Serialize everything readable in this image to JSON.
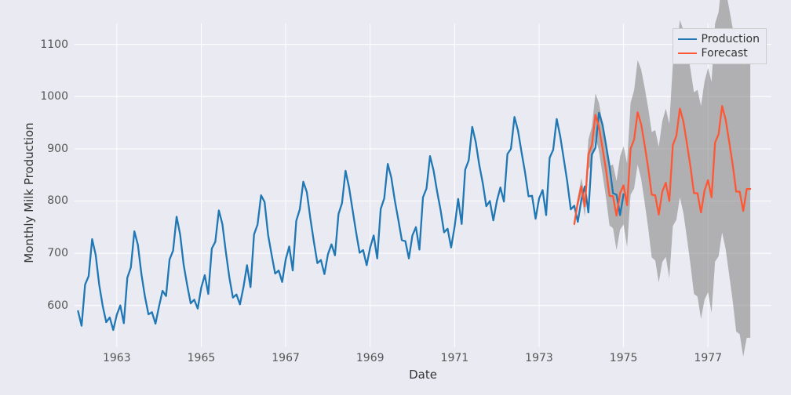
{
  "chart_data": {
    "type": "line",
    "xlabel": "Date",
    "ylabel": "Monthly Milk Production",
    "title": "",
    "xlim_year": [
      1962.0,
      1978.5
    ],
    "ylim": [
      520,
      1140
    ],
    "x_ticks": [
      1963,
      1965,
      1967,
      1969,
      1971,
      1973,
      1975,
      1977
    ],
    "y_ticks": [
      600,
      700,
      800,
      900,
      1000,
      1100
    ],
    "legend": {
      "entries": [
        "Production",
        "Forecast"
      ]
    },
    "series": [
      {
        "name": "Production",
        "color": "#1f77b4",
        "x_start_year": 1962.0833,
        "x_step_years": 0.0833333,
        "values": [
          589,
          561,
          640,
          656,
          727,
          697,
          640,
          599,
          568,
          577,
          553,
          582,
          600,
          566,
          653,
          673,
          742,
          716,
          660,
          617,
          583,
          587,
          565,
          598,
          628,
          618,
          688,
          705,
          770,
          736,
          678,
          639,
          604,
          611,
          594,
          634,
          658,
          622,
          709,
          722,
          782,
          756,
          702,
          653,
          615,
          621,
          602,
          635,
          677,
          635,
          736,
          755,
          811,
          798,
          735,
          697,
          661,
          667,
          645,
          688,
          713,
          667,
          762,
          784,
          837,
          817,
          767,
          722,
          681,
          687,
          660,
          698,
          717,
          696,
          775,
          796,
          858,
          826,
          783,
          740,
          701,
          706,
          677,
          711,
          734,
          690,
          785,
          805,
          871,
          845,
          801,
          764,
          725,
          723,
          690,
          734,
          750,
          707,
          807,
          824,
          886,
          859,
          819,
          783,
          740,
          747,
          711,
          751,
          804,
          756,
          860,
          878,
          942,
          913,
          869,
          834,
          790,
          800,
          763,
          800,
          826,
          799,
          890,
          900,
          961,
          935,
          894,
          855,
          809,
          810,
          766,
          805,
          821,
          773,
          883,
          898,
          957,
          924,
          881,
          837,
          784,
          791,
          760,
          802,
          828,
          778,
          889,
          902,
          969,
          947,
          908,
          867,
          815,
          812,
          773,
          813
        ]
      },
      {
        "name": "Forecast",
        "color": "#ff5733",
        "x_start_year": 1973.8333,
        "x_step_years": 0.0833333,
        "values": [
          756,
          798,
          828,
          790,
          889,
          907,
          965,
          942,
          902,
          860,
          810,
          809,
          772,
          815,
          830,
          792,
          900,
          918,
          970,
          947,
          907,
          863,
          812,
          811,
          774,
          818,
          835,
          800,
          907,
          925,
          977,
          952,
          910,
          866,
          815,
          815,
          778,
          820,
          840,
          807,
          912,
          928,
          982,
          956,
          914,
          870,
          818,
          818,
          781,
          823,
          823
        ]
      }
    ],
    "confidence_band": {
      "x_start_year": 1973.8333,
      "x_step_years": 0.0833333,
      "lower": [
        750,
        788,
        812,
        770,
        860,
        872,
        924,
        896,
        852,
        807,
        753,
        748,
        706,
        745,
        755,
        712,
        812,
        824,
        870,
        842,
        797,
        748,
        692,
        686,
        644,
        683,
        693,
        652,
        752,
        764,
        807,
        777,
        729,
        679,
        622,
        617,
        574,
        611,
        625,
        586,
        684,
        694,
        740,
        708,
        659,
        609,
        550,
        545,
        502,
        538,
        538
      ],
      "upper": [
        762,
        808,
        844,
        810,
        918,
        942,
        1006,
        988,
        952,
        913,
        867,
        870,
        838,
        885,
        905,
        872,
        988,
        1012,
        1070,
        1052,
        1017,
        978,
        932,
        936,
        904,
        953,
        977,
        948,
        1062,
        1086,
        1147,
        1127,
        1091,
        1053,
        1008,
        1013,
        982,
        1029,
        1055,
        1028,
        1140,
        1162,
        1224,
        1204,
        1169,
        1131,
        1086,
        1091,
        1060,
        1108,
        1108
      ]
    }
  }
}
